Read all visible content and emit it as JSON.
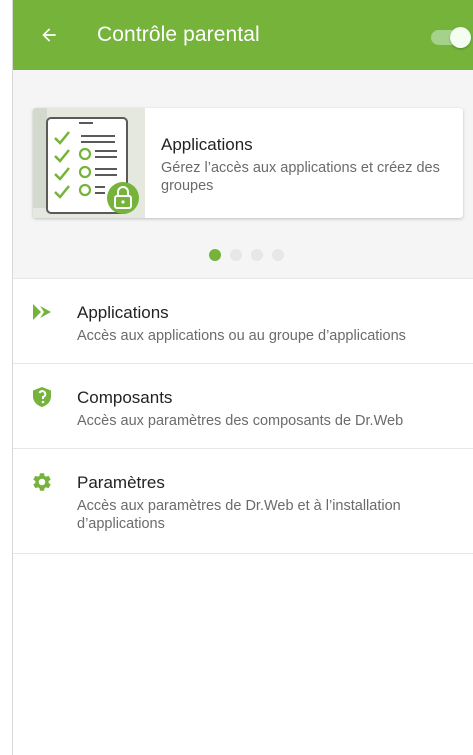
{
  "colors": {
    "accent": "#75b33b",
    "toggle_track": "#a5d28a"
  },
  "header": {
    "title": "Contrôle parental",
    "back_icon": "arrow-left-icon",
    "toggle_on": true
  },
  "banner": {
    "title": "Applications",
    "description": "Gérez l’accès aux applications et créez des groupes",
    "illustration_icon": "checklist-lock-icon",
    "page_count": 4,
    "active_page": 1
  },
  "items": [
    {
      "icon": "play-arrow-icon",
      "title": "Applications",
      "subtitle": "Accès aux applications ou au groupe d’applications"
    },
    {
      "icon": "shield-icon",
      "title": "Composants",
      "subtitle": "Accès aux paramètres des composants de Dr.Web"
    },
    {
      "icon": "gear-icon",
      "title": "Paramètres",
      "subtitle": "Accès aux paramètres de Dr.Web et à l’installation d’applications"
    }
  ]
}
